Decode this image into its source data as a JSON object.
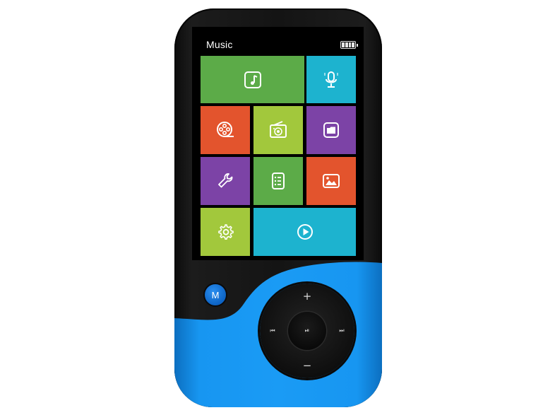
{
  "screen": {
    "title": "Music",
    "battery_icon": "battery-full-icon"
  },
  "tiles": [
    {
      "name": "tile-music",
      "icon": "music-note-icon",
      "color": "#5cab48"
    },
    {
      "name": "tile-recorder",
      "icon": "microphone-icon",
      "color": "#1db3cf"
    },
    {
      "name": "tile-video",
      "icon": "film-reel-icon",
      "color": "#e3542d"
    },
    {
      "name": "tile-radio",
      "icon": "radio-icon",
      "color": "#a2c83c"
    },
    {
      "name": "tile-folder",
      "icon": "folder-icon",
      "color": "#7c43a6"
    },
    {
      "name": "tile-tools",
      "icon": "wrench-icon",
      "color": "#7c43a6"
    },
    {
      "name": "tile-ebook",
      "icon": "document-list-icon",
      "color": "#5cab48"
    },
    {
      "name": "tile-photo",
      "icon": "picture-icon",
      "color": "#e3542d"
    },
    {
      "name": "tile-settings",
      "icon": "gear-icon",
      "color": "#a2c83c"
    },
    {
      "name": "tile-now-playing",
      "icon": "play-circle-icon",
      "color": "#1db3cf"
    }
  ],
  "controls": {
    "menu_label": "M",
    "volume_up": "+",
    "volume_down": "−",
    "previous": "⏮",
    "next": "⏭",
    "play_pause": "⏯"
  },
  "colors": {
    "body_blue": "#1496f2",
    "body_black": "#141414",
    "menu_button": "#1a7fe0"
  }
}
